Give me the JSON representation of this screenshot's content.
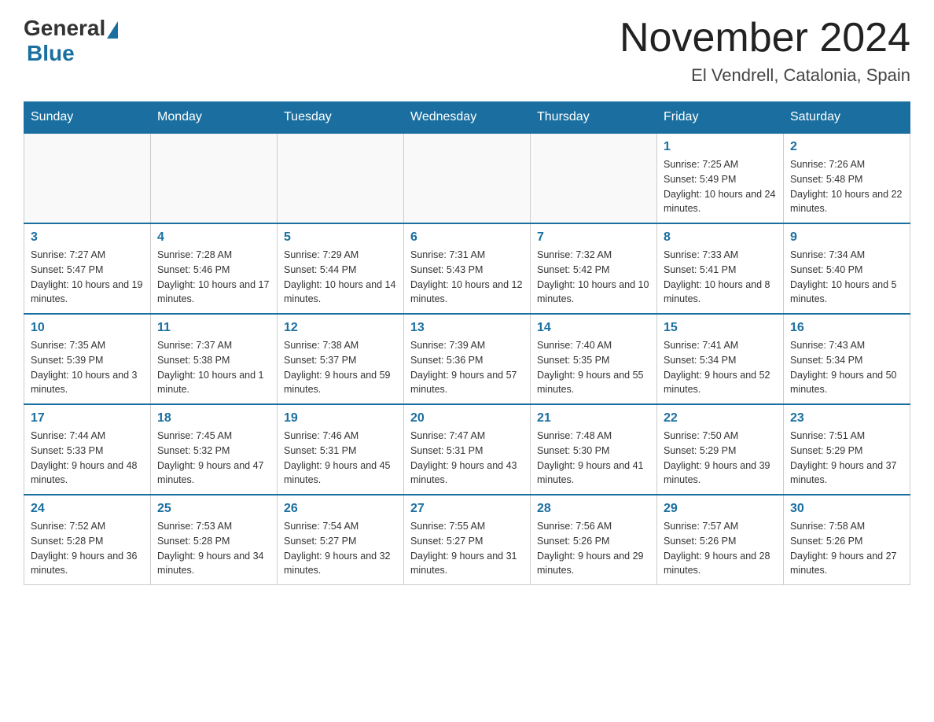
{
  "header": {
    "logo_general": "General",
    "logo_blue": "Blue",
    "month_title": "November 2024",
    "location": "El Vendrell, Catalonia, Spain"
  },
  "days_of_week": [
    "Sunday",
    "Monday",
    "Tuesday",
    "Wednesday",
    "Thursday",
    "Friday",
    "Saturday"
  ],
  "weeks": [
    [
      {
        "day": "",
        "info": ""
      },
      {
        "day": "",
        "info": ""
      },
      {
        "day": "",
        "info": ""
      },
      {
        "day": "",
        "info": ""
      },
      {
        "day": "",
        "info": ""
      },
      {
        "day": "1",
        "info": "Sunrise: 7:25 AM\nSunset: 5:49 PM\nDaylight: 10 hours and 24 minutes."
      },
      {
        "day": "2",
        "info": "Sunrise: 7:26 AM\nSunset: 5:48 PM\nDaylight: 10 hours and 22 minutes."
      }
    ],
    [
      {
        "day": "3",
        "info": "Sunrise: 7:27 AM\nSunset: 5:47 PM\nDaylight: 10 hours and 19 minutes."
      },
      {
        "day": "4",
        "info": "Sunrise: 7:28 AM\nSunset: 5:46 PM\nDaylight: 10 hours and 17 minutes."
      },
      {
        "day": "5",
        "info": "Sunrise: 7:29 AM\nSunset: 5:44 PM\nDaylight: 10 hours and 14 minutes."
      },
      {
        "day": "6",
        "info": "Sunrise: 7:31 AM\nSunset: 5:43 PM\nDaylight: 10 hours and 12 minutes."
      },
      {
        "day": "7",
        "info": "Sunrise: 7:32 AM\nSunset: 5:42 PM\nDaylight: 10 hours and 10 minutes."
      },
      {
        "day": "8",
        "info": "Sunrise: 7:33 AM\nSunset: 5:41 PM\nDaylight: 10 hours and 8 minutes."
      },
      {
        "day": "9",
        "info": "Sunrise: 7:34 AM\nSunset: 5:40 PM\nDaylight: 10 hours and 5 minutes."
      }
    ],
    [
      {
        "day": "10",
        "info": "Sunrise: 7:35 AM\nSunset: 5:39 PM\nDaylight: 10 hours and 3 minutes."
      },
      {
        "day": "11",
        "info": "Sunrise: 7:37 AM\nSunset: 5:38 PM\nDaylight: 10 hours and 1 minute."
      },
      {
        "day": "12",
        "info": "Sunrise: 7:38 AM\nSunset: 5:37 PM\nDaylight: 9 hours and 59 minutes."
      },
      {
        "day": "13",
        "info": "Sunrise: 7:39 AM\nSunset: 5:36 PM\nDaylight: 9 hours and 57 minutes."
      },
      {
        "day": "14",
        "info": "Sunrise: 7:40 AM\nSunset: 5:35 PM\nDaylight: 9 hours and 55 minutes."
      },
      {
        "day": "15",
        "info": "Sunrise: 7:41 AM\nSunset: 5:34 PM\nDaylight: 9 hours and 52 minutes."
      },
      {
        "day": "16",
        "info": "Sunrise: 7:43 AM\nSunset: 5:34 PM\nDaylight: 9 hours and 50 minutes."
      }
    ],
    [
      {
        "day": "17",
        "info": "Sunrise: 7:44 AM\nSunset: 5:33 PM\nDaylight: 9 hours and 48 minutes."
      },
      {
        "day": "18",
        "info": "Sunrise: 7:45 AM\nSunset: 5:32 PM\nDaylight: 9 hours and 47 minutes."
      },
      {
        "day": "19",
        "info": "Sunrise: 7:46 AM\nSunset: 5:31 PM\nDaylight: 9 hours and 45 minutes."
      },
      {
        "day": "20",
        "info": "Sunrise: 7:47 AM\nSunset: 5:31 PM\nDaylight: 9 hours and 43 minutes."
      },
      {
        "day": "21",
        "info": "Sunrise: 7:48 AM\nSunset: 5:30 PM\nDaylight: 9 hours and 41 minutes."
      },
      {
        "day": "22",
        "info": "Sunrise: 7:50 AM\nSunset: 5:29 PM\nDaylight: 9 hours and 39 minutes."
      },
      {
        "day": "23",
        "info": "Sunrise: 7:51 AM\nSunset: 5:29 PM\nDaylight: 9 hours and 37 minutes."
      }
    ],
    [
      {
        "day": "24",
        "info": "Sunrise: 7:52 AM\nSunset: 5:28 PM\nDaylight: 9 hours and 36 minutes."
      },
      {
        "day": "25",
        "info": "Sunrise: 7:53 AM\nSunset: 5:28 PM\nDaylight: 9 hours and 34 minutes."
      },
      {
        "day": "26",
        "info": "Sunrise: 7:54 AM\nSunset: 5:27 PM\nDaylight: 9 hours and 32 minutes."
      },
      {
        "day": "27",
        "info": "Sunrise: 7:55 AM\nSunset: 5:27 PM\nDaylight: 9 hours and 31 minutes."
      },
      {
        "day": "28",
        "info": "Sunrise: 7:56 AM\nSunset: 5:26 PM\nDaylight: 9 hours and 29 minutes."
      },
      {
        "day": "29",
        "info": "Sunrise: 7:57 AM\nSunset: 5:26 PM\nDaylight: 9 hours and 28 minutes."
      },
      {
        "day": "30",
        "info": "Sunrise: 7:58 AM\nSunset: 5:26 PM\nDaylight: 9 hours and 27 minutes."
      }
    ]
  ]
}
